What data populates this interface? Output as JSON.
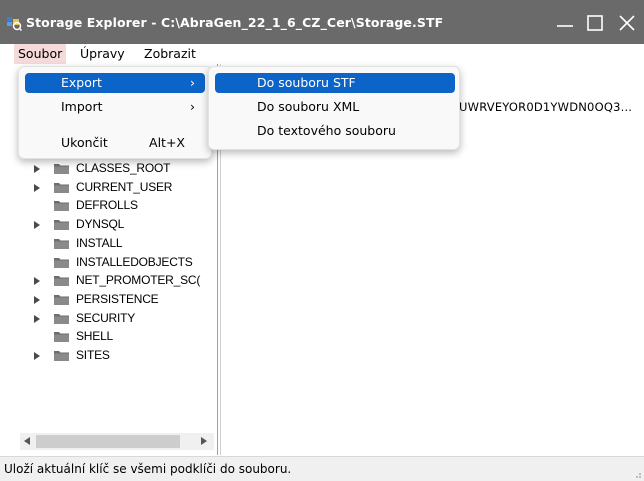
{
  "window": {
    "title": "Storage Explorer - C:\\AbraGen_22_1_6_CZ_Cer\\Storage.STF",
    "controls": {
      "minimize": "minimize-icon",
      "maximize": "maximize-icon",
      "close": "close-icon"
    }
  },
  "menubar": {
    "items": [
      "Soubor",
      "Úpravy",
      "Zobrazit"
    ],
    "active": "Soubor"
  },
  "file_menu": {
    "items": [
      {
        "label": "Export",
        "arrow": "›",
        "highlighted": true
      },
      {
        "label": "Import",
        "arrow": "›"
      },
      {
        "label": "Ukončit",
        "shortcut": "Alt+X"
      }
    ]
  },
  "export_submenu": {
    "items": [
      {
        "label": "Do souboru STF",
        "highlighted": true
      },
      {
        "label": "Do souboru XML"
      },
      {
        "label": "Do textového souboru"
      }
    ]
  },
  "tree": {
    "items": [
      {
        "label": "CLASSES_ROOT",
        "expandable": true
      },
      {
        "label": "CURRENT_USER",
        "expandable": true
      },
      {
        "label": "DEFROLLS",
        "expandable": false
      },
      {
        "label": "DYNSQL",
        "expandable": true
      },
      {
        "label": "INSTALL",
        "expandable": false
      },
      {
        "label": "INSTALLEDOBJECTS",
        "expandable": false
      },
      {
        "label": "NET_PROMOTER_SC(",
        "expandable": true
      },
      {
        "label": "PERSISTENCE",
        "expandable": true
      },
      {
        "label": "SECURITY",
        "expandable": true
      },
      {
        "label": "SHELL",
        "expandable": false
      },
      {
        "label": "SITES",
        "expandable": true
      }
    ]
  },
  "right_panel": {
    "value_text": "UWRVEYOR0D1YWDN0OQ3..."
  },
  "statusbar": {
    "text": "Uloží aktuální klíč se všemi podklíči do souboru."
  },
  "colors": {
    "titlebar": "#6a6a6a",
    "highlight": "#0c64c8",
    "menu_active": "#f5dada",
    "statusbar": "#f0f0f0"
  }
}
